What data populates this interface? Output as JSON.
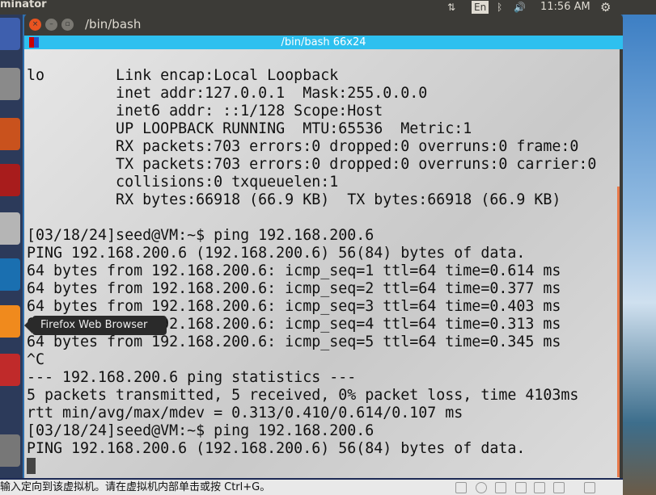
{
  "topbar": {
    "app": "minator",
    "keyboard": "En",
    "time": "11:56 AM"
  },
  "window": {
    "title": "/bin/bash",
    "tab_title": "/bin/bash 66x24"
  },
  "terminal": {
    "lines": [
      "",
      "lo        Link encap:Local Loopback",
      "          inet addr:127.0.0.1  Mask:255.0.0.0",
      "          inet6 addr: ::1/128 Scope:Host",
      "          UP LOOPBACK RUNNING  MTU:65536  Metric:1",
      "          RX packets:703 errors:0 dropped:0 overruns:0 frame:0",
      "          TX packets:703 errors:0 dropped:0 overruns:0 carrier:0",
      "          collisions:0 txqueuelen:1",
      "          RX bytes:66918 (66.9 KB)  TX bytes:66918 (66.9 KB)",
      "",
      "[03/18/24]seed@VM:~$ ping 192.168.200.6",
      "PING 192.168.200.6 (192.168.200.6) 56(84) bytes of data.",
      "64 bytes from 192.168.200.6: icmp_seq=1 ttl=64 time=0.614 ms",
      "64 bytes from 192.168.200.6: icmp_seq=2 ttl=64 time=0.377 ms",
      "64 bytes from 192.168.200.6: icmp_seq=3 ttl=64 time=0.403 ms",
      "64 bytes from 192.168.200.6: icmp_seq=4 ttl=64 time=0.313 ms",
      "64 bytes from 192.168.200.6: icmp_seq=5 ttl=64 time=0.345 ms",
      "^C",
      "--- 192.168.200.6 ping statistics ---",
      "5 packets transmitted, 5 received, 0% packet loss, time 4103ms",
      "rtt min/avg/max/mdev = 0.313/0.410/0.614/0.107 ms",
      "[03/18/24]seed@VM:~$ ping 192.168.200.6",
      "PING 192.168.200.6 (192.168.200.6) 56(84) bytes of data.",
      ""
    ]
  },
  "tooltip": "Firefox Web Browser",
  "status": {
    "message": "输入定向到该虚拟机。请在虚拟机内部单击或按 Ctrl+G。"
  }
}
